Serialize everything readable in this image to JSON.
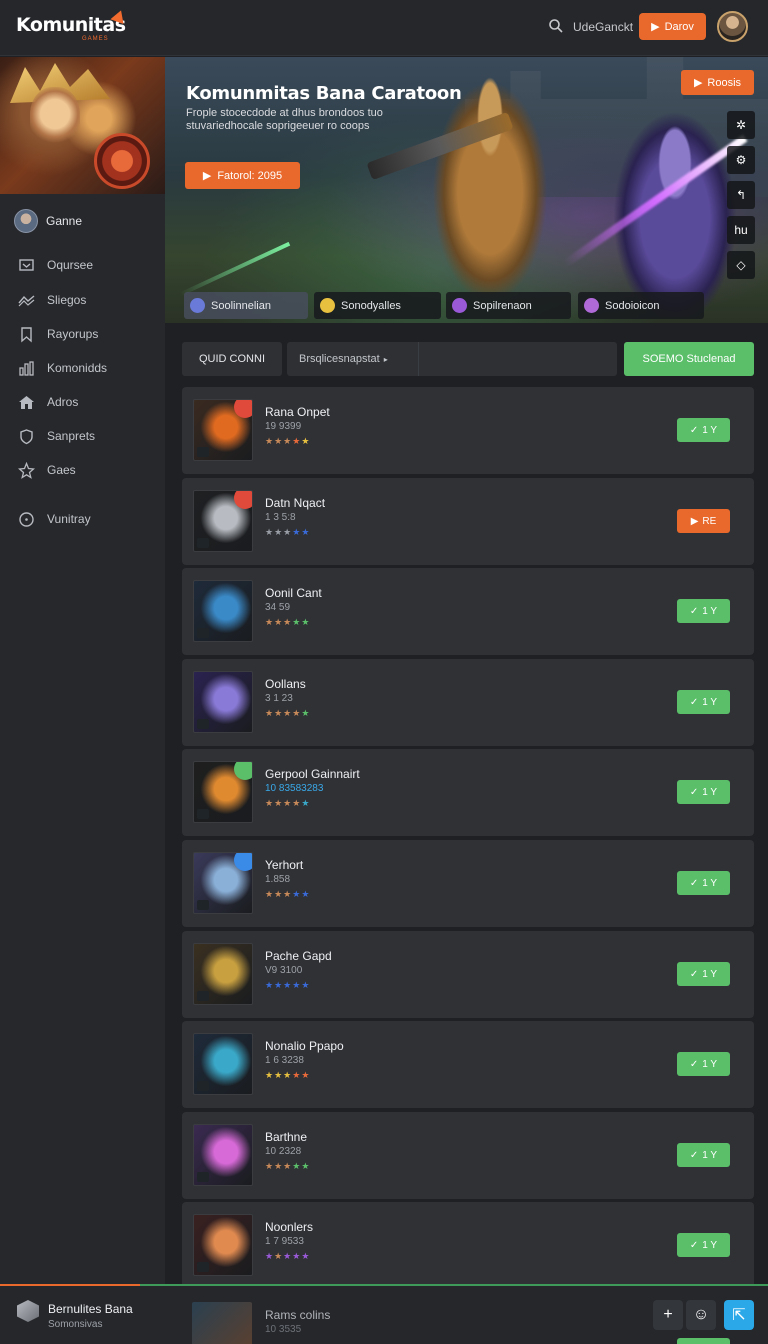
{
  "header": {
    "logo": "Komunitas",
    "logo_sub": "GAMES",
    "user_label": "UdeGanckt",
    "action_label": "Darov"
  },
  "sidebar": {
    "user_name": "Ganne",
    "items": [
      {
        "label": "Oqursee",
        "icon": "comment-icon"
      },
      {
        "label": "Sliegos",
        "icon": "trending-icon"
      },
      {
        "label": "Rayorups",
        "icon": "bookmark-icon"
      },
      {
        "label": "Komonidds",
        "icon": "chart-icon"
      },
      {
        "label": "Adros",
        "icon": "home-icon"
      },
      {
        "label": "Sanprets",
        "icon": "shield-icon"
      },
      {
        "label": "Gaes",
        "icon": "star-icon"
      },
      {
        "label": "Vunitray",
        "icon": "clock-icon"
      }
    ]
  },
  "banner": {
    "title": "Komunmitas Bana Caratoon",
    "description": "Frople stocecdode at dhus brondoos tuo stuvariedhocale soprigeeuer ro coops",
    "cta_label": "Fatorol: 2095",
    "corner_label": "Roosis",
    "tools": [
      "settings-icon",
      "gear-icon",
      "back-icon",
      "text-icon",
      "diamond-icon"
    ],
    "tool_text": "hu",
    "tabs": [
      {
        "label": "Soolinnelian",
        "color": "#6a7ad8"
      },
      {
        "label": "Sonodyalles",
        "color": "#e8c040"
      },
      {
        "label": "Sopilrenaon",
        "color": "#9a5ad8"
      },
      {
        "label": "Sodoioicon",
        "color": "#b06ad8"
      }
    ]
  },
  "filter": {
    "label": "QUID CONNI",
    "select_value": "Brsqlicesnapstat",
    "button_label": "SOEMO Stuclenad"
  },
  "list": [
    {
      "name": "Rana Onpet",
      "meta": "19 9399",
      "stars": [
        "#c98a5a",
        "#c98a5a",
        "#c98a5a",
        "#e86a3a",
        "#e8c040"
      ],
      "button": "green",
      "btn_label": "1 Y",
      "meta_color": "#9ea2a8",
      "theme": [
        "#e06a20",
        "#3a2a20"
      ],
      "badge": "#e04a3a"
    },
    {
      "name": "Datn Nqact",
      "meta": "1 3 5:8",
      "stars": [
        "#9a9ea6",
        "#9a9ea6",
        "#9a9ea6",
        "#3a6ad8",
        "#3a6ad8"
      ],
      "button": "orange",
      "btn_label": "RE",
      "meta_color": "#9ea2a8",
      "theme": [
        "#b8bcc2",
        "#1e2022"
      ],
      "badge": "#e04a3a"
    },
    {
      "name": "Oonil Cant",
      "meta": "34 59",
      "stars": [
        "#c98a5a",
        "#c98a5a",
        "#c98a5a",
        "#5bbf6a",
        "#5bbf6a"
      ],
      "button": "green",
      "btn_label": "1 Y",
      "meta_color": "#9ea2a8",
      "theme": [
        "#3a8ac8",
        "#1e2a3a"
      ],
      "badge": "none"
    },
    {
      "name": "Oollans",
      "meta": "3 1 23",
      "stars": [
        "#c98a5a",
        "#c98a5a",
        "#c98a5a",
        "#c98a5a",
        "#5bbf6a"
      ],
      "button": "green",
      "btn_label": "1 Y",
      "meta_color": "#9ea2a8",
      "theme": [
        "#8a7ad8",
        "#2a2250"
      ],
      "badge": "none"
    },
    {
      "name": "Gerpool Gainnairt",
      "meta": "10 83583283",
      "stars": [
        "#c98a5a",
        "#c98a5a",
        "#c98a5a",
        "#c98a5a",
        "#3aa8c8"
      ],
      "button": "green",
      "btn_label": "1 Y",
      "meta_color": "#3aa8e8",
      "theme": [
        "#e08a30",
        "#1e1e1e"
      ],
      "badge": "#5bbf6a"
    },
    {
      "name": "Yerhort",
      "meta": "1.858",
      "stars": [
        "#c98a5a",
        "#c98a5a",
        "#c98a5a",
        "#3a6ad8",
        "#3a6ad8"
      ],
      "button": "green",
      "btn_label": "1 Y",
      "meta_color": "#9ea2a8",
      "theme": [
        "#8ab0d8",
        "#3a3a5a"
      ],
      "badge": "#3a8ae8"
    },
    {
      "name": "Pache Gapd",
      "meta": "V9 3100",
      "stars": [
        "#3a6ad8",
        "#3a6ad8",
        "#3a6ad8",
        "#3a6ad8",
        "#3a6ad8"
      ],
      "button": "green",
      "btn_label": "1 Y",
      "meta_color": "#9ea2a8",
      "theme": [
        "#c8a040",
        "#3a3020"
      ],
      "badge": "none"
    },
    {
      "name": "Nonalio Ppapo",
      "meta": "1 6 3238",
      "stars": [
        "#e8c040",
        "#e8c040",
        "#e8c040",
        "#e86a3a",
        "#e86a3a"
      ],
      "button": "green",
      "btn_label": "1 Y",
      "meta_color": "#9ea2a8",
      "theme": [
        "#3aa8c8",
        "#1e2a3a"
      ],
      "badge": "none"
    },
    {
      "name": "Barthne",
      "meta": "10 2328",
      "stars": [
        "#c98a5a",
        "#c98a5a",
        "#c98a5a",
        "#5bbf6a",
        "#5bbf6a"
      ],
      "button": "green",
      "btn_label": "1 Y",
      "meta_color": "#9ea2a8",
      "theme": [
        "#d86ad8",
        "#3a2a50"
      ],
      "badge": "none"
    },
    {
      "name": "Noonlers",
      "meta": "1 7 9533",
      "stars": [
        "#9a5ad8",
        "#c98a5a",
        "#9a5ad8",
        "#9a5ad8",
        "#9a5ad8"
      ],
      "button": "green",
      "btn_label": "1 Y",
      "meta_color": "#9ea2a8",
      "theme": [
        "#e08a50",
        "#3a2020"
      ],
      "badge": "none"
    }
  ],
  "bottom": {
    "title": "Bernulites Bana",
    "subtitle": "Somonsivas",
    "peek_name": "Rams colins",
    "peek_meta": "10 3535",
    "buttons": [
      "plus-icon",
      "smile-icon",
      "share-icon"
    ]
  }
}
